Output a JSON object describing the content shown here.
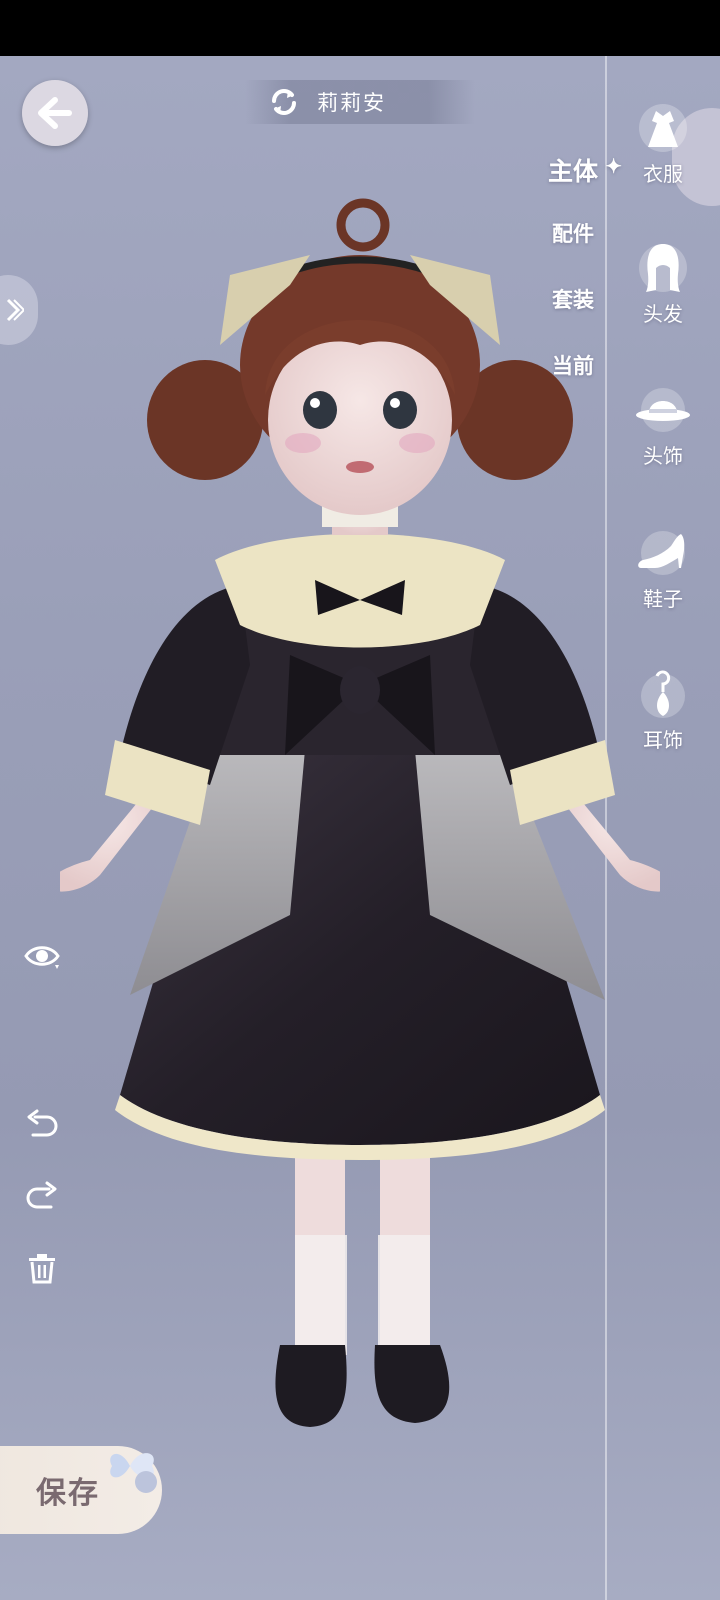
{
  "header": {
    "character_name": "莉莉安"
  },
  "category_tabs": [
    {
      "label": "主体",
      "active": true
    },
    {
      "label": "配件",
      "active": false
    },
    {
      "label": "套装",
      "active": false
    },
    {
      "label": "当前",
      "active": false
    }
  ],
  "wardrobe_categories": [
    {
      "label": "衣服",
      "icon": "dress-icon"
    },
    {
      "label": "头发",
      "icon": "hair-icon"
    },
    {
      "label": "头饰",
      "icon": "hat-icon"
    },
    {
      "label": "鞋子",
      "icon": "shoe-icon"
    },
    {
      "label": "耳饰",
      "icon": "earring-icon"
    }
  ],
  "actions": {
    "save_label": "保存"
  },
  "colors": {
    "accent": "#ffffff",
    "save_bg": "#f1e9e2",
    "save_text": "#7a6a70",
    "background": "#9ea3bc"
  }
}
